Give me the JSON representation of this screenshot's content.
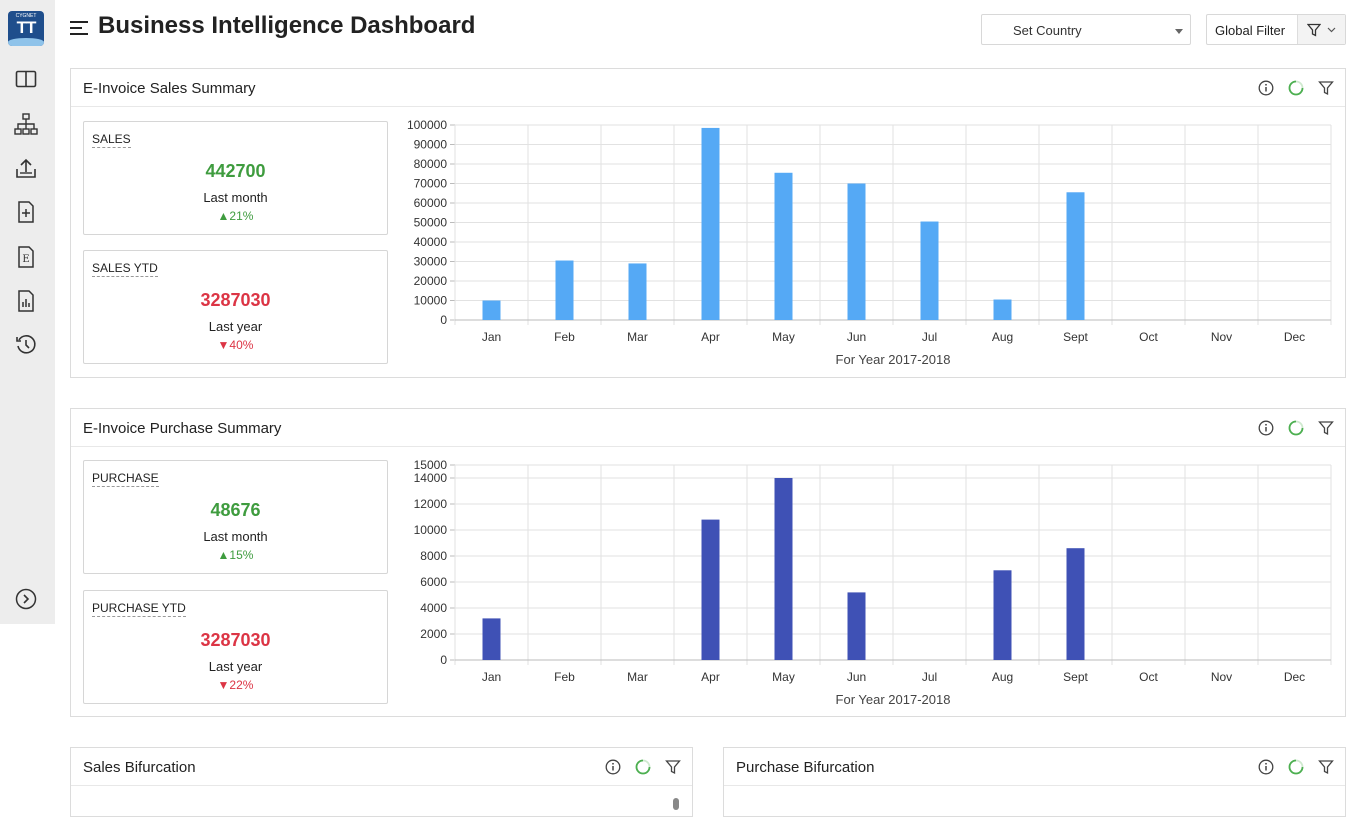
{
  "app": {
    "logo_small": "CYGNET",
    "logo_main": "TT",
    "title": "Business Intelligence Dashboard"
  },
  "header": {
    "country_select": "Set Country",
    "global_filter": "Global Filter"
  },
  "sidebar_icons": [
    "panel-icon",
    "hierarchy-icon",
    "upload-icon",
    "add-document-icon",
    "e-document-icon",
    "report-icon",
    "history-icon",
    "expand-icon"
  ],
  "sales_panel": {
    "title": "E-Invoice Sales Summary",
    "card1": {
      "label": "SALES",
      "value": "442700",
      "period": "Last month",
      "change": "21%",
      "direction": "up"
    },
    "card2": {
      "label": "SALES YTD",
      "value": "3287030",
      "period": "Last year",
      "change": "40%",
      "direction": "down"
    }
  },
  "purchase_panel": {
    "title": "E-Invoice Purchase Summary",
    "card1": {
      "label": "PURCHASE",
      "value": "48676",
      "period": "Last month",
      "change": "15%",
      "direction": "up"
    },
    "card2": {
      "label": "PURCHASE YTD",
      "value": "3287030",
      "period": "Last year",
      "change": "22%",
      "direction": "down"
    }
  },
  "sales_bifurcation": {
    "title": "Sales Bifurcation"
  },
  "purchase_bifurcation": {
    "title": "Purchase Bifurcation"
  },
  "colors": {
    "sales_bar": "#55a9f5",
    "purchase_bar": "#3f51b5",
    "up": "#3f9c3f",
    "down": "#dc3545",
    "loader": "#4caf50"
  },
  "chart_data": [
    {
      "type": "bar",
      "categories": [
        "Jan",
        "Feb",
        "Mar",
        "Apr",
        "May",
        "Jun",
        "Jul",
        "Aug",
        "Sept",
        "Oct",
        "Nov",
        "Dec"
      ],
      "values": [
        10000,
        30500,
        29000,
        98500,
        75500,
        70000,
        50500,
        10500,
        65500,
        0,
        0,
        0
      ],
      "title": "",
      "xlabel": "For Year 2017-2018",
      "ylabel": "",
      "ylim": [
        0,
        100000
      ],
      "yticks": [
        0,
        10000,
        20000,
        30000,
        40000,
        50000,
        60000,
        70000,
        80000,
        90000,
        100000
      ],
      "grid": true
    },
    {
      "type": "bar",
      "categories": [
        "Jan",
        "Feb",
        "Mar",
        "Apr",
        "May",
        "Jun",
        "Jul",
        "Aug",
        "Sept",
        "Oct",
        "Nov",
        "Dec"
      ],
      "values": [
        3200,
        0,
        0,
        10800,
        14000,
        5200,
        0,
        6900,
        8600,
        0,
        0,
        0
      ],
      "title": "",
      "xlabel": "For Year 2017-2018",
      "ylabel": "",
      "ylim": [
        0,
        15000
      ],
      "yticks": [
        0,
        2000,
        4000,
        6000,
        8000,
        10000,
        12000,
        14000,
        15000
      ],
      "grid": true
    }
  ]
}
